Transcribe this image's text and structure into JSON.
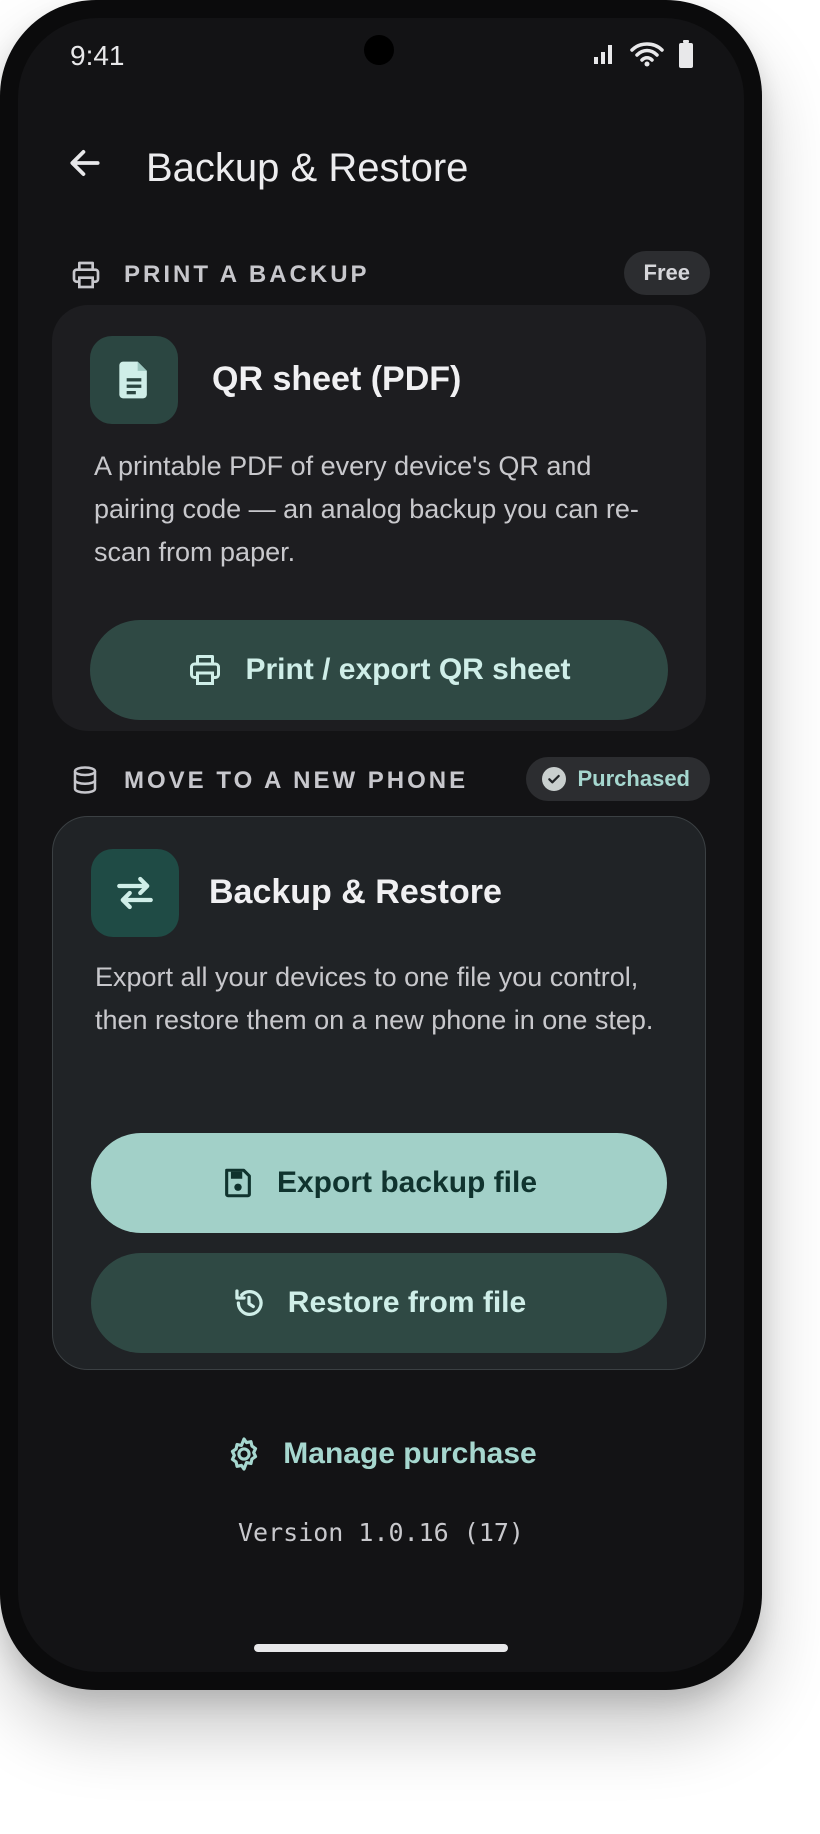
{
  "status_bar": {
    "time": "9:41"
  },
  "app_bar": {
    "title": "Backup & Restore",
    "back_icon": "arrow-back-icon"
  },
  "print_section": {
    "heading": "PRINT A BACKUP",
    "badge": "Free",
    "card": {
      "title": "QR sheet (PDF)",
      "description": "A printable PDF of every device's QR and pairing code — an analog backup you can re-scan from paper.",
      "button_label": "Print / export QR sheet"
    }
  },
  "move_section": {
    "heading": "MOVE TO A NEW PHONE",
    "badge": "Purchased",
    "card": {
      "title": "Backup & Restore",
      "description": "Export all your devices to one file you control, then restore them on a new phone in one step.",
      "export_label": "Export backup file",
      "restore_label": "Restore from file"
    }
  },
  "footer": {
    "manage_label": "Manage purchase",
    "version": "Version 1.0.16 (17)"
  },
  "colors": {
    "background": "#131315",
    "card": "#1d1d20",
    "accent": "#a2d0c8",
    "tonal_button": "#2f4944"
  }
}
